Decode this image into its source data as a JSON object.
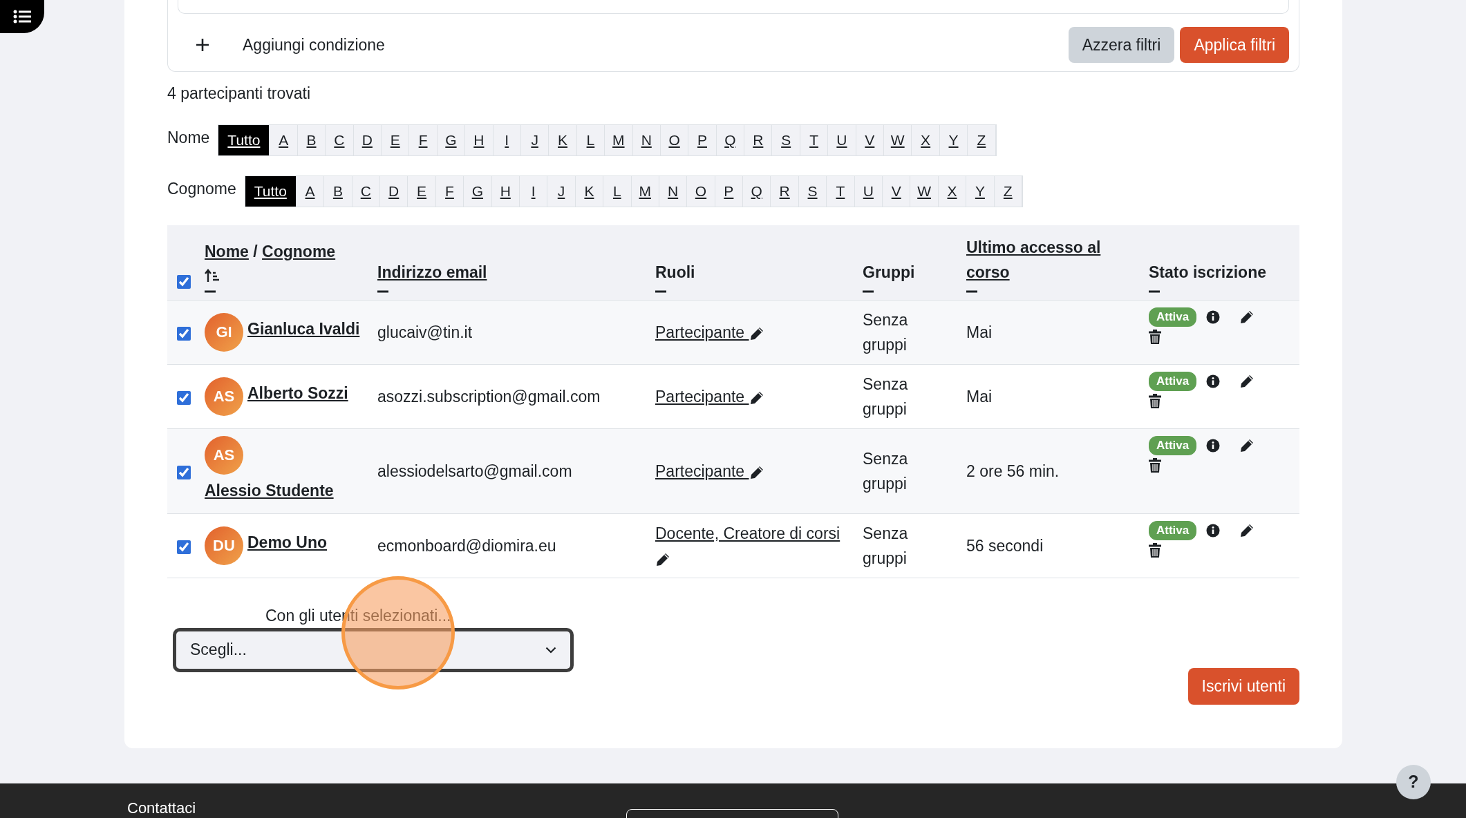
{
  "filter": {
    "add_label": "Aggiungi condizione",
    "buttons": [
      {
        "label": "Azzera filtri",
        "kind": "secondary"
      },
      {
        "label": "Applica filtri",
        "kind": "primary"
      }
    ]
  },
  "result_count": "4 partecipanti trovati",
  "initials_bars": [
    {
      "label": "Nome",
      "options": [
        {
          "label": "Tutto",
          "selected": true
        },
        {
          "label": "A",
          "selected": false
        },
        {
          "label": "B",
          "selected": false
        },
        {
          "label": "C",
          "selected": false
        },
        {
          "label": "D",
          "selected": false
        },
        {
          "label": "E",
          "selected": false
        },
        {
          "label": "F",
          "selected": false
        },
        {
          "label": "G",
          "selected": false
        },
        {
          "label": "H",
          "selected": false
        },
        {
          "label": "I",
          "selected": false
        },
        {
          "label": "J",
          "selected": false
        },
        {
          "label": "K",
          "selected": false
        },
        {
          "label": "L",
          "selected": false
        },
        {
          "label": "M",
          "selected": false
        },
        {
          "label": "N",
          "selected": false
        },
        {
          "label": "O",
          "selected": false
        },
        {
          "label": "P",
          "selected": false
        },
        {
          "label": "Q",
          "selected": false
        },
        {
          "label": "R",
          "selected": false
        },
        {
          "label": "S",
          "selected": false
        },
        {
          "label": "T",
          "selected": false
        },
        {
          "label": "U",
          "selected": false
        },
        {
          "label": "V",
          "selected": false
        },
        {
          "label": "W",
          "selected": false
        },
        {
          "label": "X",
          "selected": false
        },
        {
          "label": "Y",
          "selected": false
        },
        {
          "label": "Z",
          "selected": false
        }
      ]
    },
    {
      "label": "Cognome",
      "options": [
        {
          "label": "Tutto",
          "selected": true
        },
        {
          "label": "A",
          "selected": false
        },
        {
          "label": "B",
          "selected": false
        },
        {
          "label": "C",
          "selected": false
        },
        {
          "label": "D",
          "selected": false
        },
        {
          "label": "E",
          "selected": false
        },
        {
          "label": "F",
          "selected": false
        },
        {
          "label": "G",
          "selected": false
        },
        {
          "label": "H",
          "selected": false
        },
        {
          "label": "I",
          "selected": false
        },
        {
          "label": "J",
          "selected": false
        },
        {
          "label": "K",
          "selected": false
        },
        {
          "label": "L",
          "selected": false
        },
        {
          "label": "M",
          "selected": false
        },
        {
          "label": "N",
          "selected": false
        },
        {
          "label": "O",
          "selected": false
        },
        {
          "label": "P",
          "selected": false
        },
        {
          "label": "Q",
          "selected": false
        },
        {
          "label": "R",
          "selected": false
        },
        {
          "label": "S",
          "selected": false
        },
        {
          "label": "T",
          "selected": false
        },
        {
          "label": "U",
          "selected": false
        },
        {
          "label": "V",
          "selected": false
        },
        {
          "label": "W",
          "selected": false
        },
        {
          "label": "X",
          "selected": false
        },
        {
          "label": "Y",
          "selected": false
        },
        {
          "label": "Z",
          "selected": false
        }
      ]
    }
  ],
  "table": {
    "select_all_checked": true,
    "columns": [
      {
        "links": [
          "Nome",
          "Cognome"
        ],
        "separator": "/",
        "sorted": true
      },
      {
        "links": [
          "Indirizzo email"
        ]
      },
      {
        "label": "Ruoli"
      },
      {
        "label": "Gruppi"
      },
      {
        "links": [
          "Ultimo accesso al corso"
        ]
      },
      {
        "label": "Stato iscrizione"
      }
    ],
    "rows": [
      {
        "checked": true,
        "initials": "GI",
        "name": "Gianluca Ivaldi",
        "email": "glucaiv@tin.it",
        "roles": "Partecipante",
        "groups": "Senza gruppi",
        "last_access": "Mai",
        "status": "Attiva"
      },
      {
        "checked": true,
        "initials": "AS",
        "name": "Alberto Sozzi",
        "email": "asozzi.subscription@gmail.com",
        "roles": "Partecipante",
        "groups": "Senza gruppi",
        "last_access": "Mai",
        "status": "Attiva"
      },
      {
        "checked": true,
        "initials": "AS",
        "name": "Alessio Studente",
        "email": "alessiodelsarto@gmail.com",
        "roles": "Partecipante",
        "groups": "Senza gruppi",
        "last_access": "2 ore 56 min.",
        "status": "Attiva"
      },
      {
        "checked": true,
        "initials": "DU",
        "name": "Demo Uno",
        "email": "ecmonboard@diomira.eu",
        "roles": "Docente, Creatore di corsi",
        "groups": "Senza gruppi",
        "last_access": "56 secondi",
        "status": "Attiva"
      }
    ]
  },
  "bulk": {
    "label": "Con gli utenti selezionati...",
    "value": "Scegli..."
  },
  "enrol_button": "Iscrivi utenti",
  "footer": {
    "heading": "Contattaci"
  },
  "help_button": "?"
}
